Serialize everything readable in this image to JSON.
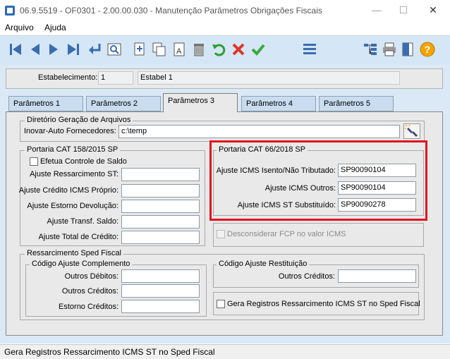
{
  "window": {
    "title": "06.9.5519 - OF0301 - 2.00.00.030 - Manutenção Parâmetros Obrigações Fiscais",
    "minimize": "—",
    "maximize": "☐",
    "close": "✕"
  },
  "menu": {
    "items": [
      "Arquivo",
      "Ajuda"
    ]
  },
  "toolbar": {
    "icons": [
      "first-icon",
      "prev-icon",
      "next-icon",
      "last-icon",
      "goto-icon",
      "search-icon",
      "new-icon",
      "copy-icon",
      "edit-icon",
      "delete-icon",
      "undo-icon",
      "cancel-icon",
      "save-icon",
      "list-icon",
      "tree-icon",
      "print-icon",
      "exit-icon",
      "help-icon"
    ]
  },
  "header": {
    "estab_label": "Estabelecimento:",
    "estab_code": "1",
    "estab_name": "Estabel 1"
  },
  "tabs": [
    "Parâmetros 1",
    "Parâmetros 2",
    "Parâmetros 3",
    "Parâmetros 4",
    "Parâmetros 5"
  ],
  "active_tab": "Parâmetros 3",
  "diretorio": {
    "title": "Diretório Geração de Arquivos",
    "label": "Inovar-Auto Fornecedores:",
    "value": "c:\\temp"
  },
  "cat158": {
    "title": "Portaria CAT 158/2015 SP",
    "checkbox_label": "Efetua Controle de Saldo",
    "fields": [
      {
        "label": "Ajuste Ressarcimento ST:",
        "value": ""
      },
      {
        "label": "Ajuste Crédito ICMS Próprio:",
        "value": ""
      },
      {
        "label": "Ajuste Estorno Devolução:",
        "value": ""
      },
      {
        "label": "Ajuste Transf. Saldo:",
        "value": ""
      },
      {
        "label": "Ajuste Total de Crédito:",
        "value": ""
      }
    ]
  },
  "cat66": {
    "title": "Portaria CAT 66/2018 SP",
    "fields": [
      {
        "label": "Ajuste ICMS Isento/Não Tributado:",
        "value": "SP90090104"
      },
      {
        "label": "Ajuste ICMS Outros:",
        "value": "SP90090104"
      },
      {
        "label": "Ajuste ICMS ST Substituído:",
        "value": "SP90090278"
      }
    ],
    "highlight_color": "#e0141e"
  },
  "fcp": {
    "label": "Desconsiderar FCP no valor ICMS"
  },
  "ressarcimento": {
    "title": "Ressarcimento Sped Fiscal",
    "complemento": {
      "title": "Código Ajuste Complemento",
      "fields": [
        {
          "label": "Outros Débitos:",
          "value": ""
        },
        {
          "label": "Outros Créditos:",
          "value": ""
        },
        {
          "label": "Estorno Créditos:",
          "value": ""
        }
      ]
    },
    "restituicao": {
      "title": "Código Ajuste Restituição",
      "label": "Outros Créditos:",
      "value": ""
    },
    "gera_label": "Gera Registros Ressarcimento ICMS ST no Sped Fiscal"
  },
  "status": {
    "text": "Gera Registros Ressarcimento ICMS ST no Sped Fiscal"
  }
}
